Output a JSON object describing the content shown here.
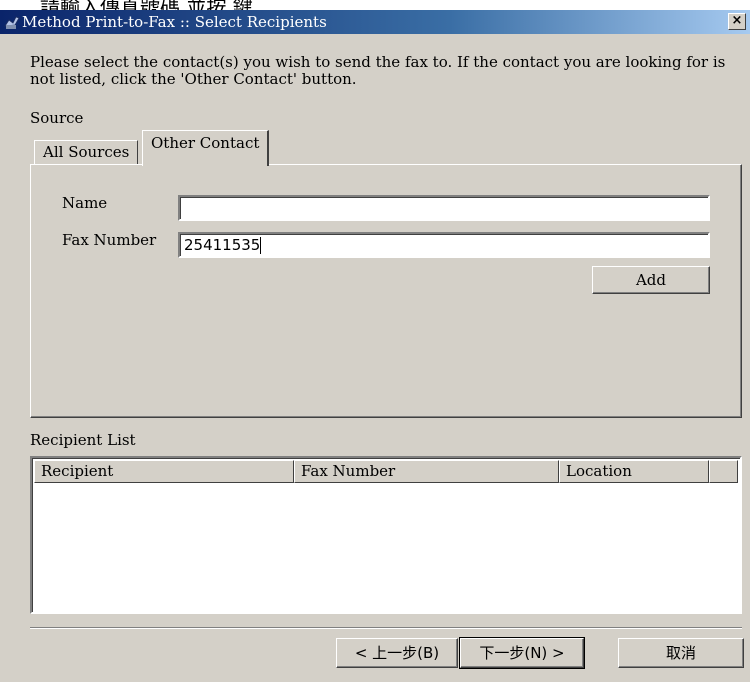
{
  "caption_fragment": "請輸入傳真號碼 並按           鍵",
  "window": {
    "title": "Method Print-to-Fax :: Select Recipients",
    "close_label": "×"
  },
  "instructions": "Please select the contact(s) you wish to send the fax to. If the contact you are looking for is not listed, click the 'Other Contact' button.",
  "source_label": "Source",
  "tabs": [
    {
      "label": "All Sources",
      "active": false
    },
    {
      "label": "Other Contact",
      "active": true
    }
  ],
  "form": {
    "name_label": "Name",
    "name_value": "",
    "fax_label": "Fax Number",
    "fax_value": "25411535",
    "add_label": "Add"
  },
  "recipient_list": {
    "label": "Recipient List",
    "columns": [
      "Recipient",
      "Fax Number",
      "Location"
    ],
    "rows": []
  },
  "footer": {
    "back_label": "< 上一步(B)",
    "next_label": "下一步(N) >",
    "cancel_label": "取消"
  },
  "icons": {
    "app_icon": "fax-app-icon"
  }
}
